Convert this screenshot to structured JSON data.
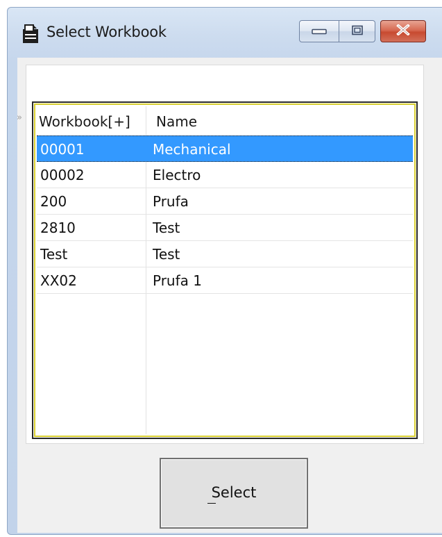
{
  "window": {
    "title": "Select Workbook",
    "icons": {
      "app": "workbook-icon",
      "minimize": "minimize-icon",
      "maximize": "maximize-icon",
      "close": "close-icon"
    },
    "colors": {
      "selection": "#3399ff",
      "grid_outline": "#d8cf30",
      "close_button": "#c74a30"
    }
  },
  "grid": {
    "expander_glyph": "»",
    "columns": [
      "Workbook[+]",
      "Name"
    ],
    "rows": [
      {
        "workbook": "00001",
        "name": "Mechanical",
        "selected": true
      },
      {
        "workbook": "00002",
        "name": "Electro",
        "selected": false
      },
      {
        "workbook": "200",
        "name": "Prufa",
        "selected": false
      },
      {
        "workbook": "2810",
        "name": "Test",
        "selected": false
      },
      {
        "workbook": "Test",
        "name": "Test",
        "selected": false
      },
      {
        "workbook": "XX02",
        "name": "Prufa 1",
        "selected": false
      }
    ]
  },
  "buttons": {
    "select_label": "Select"
  }
}
